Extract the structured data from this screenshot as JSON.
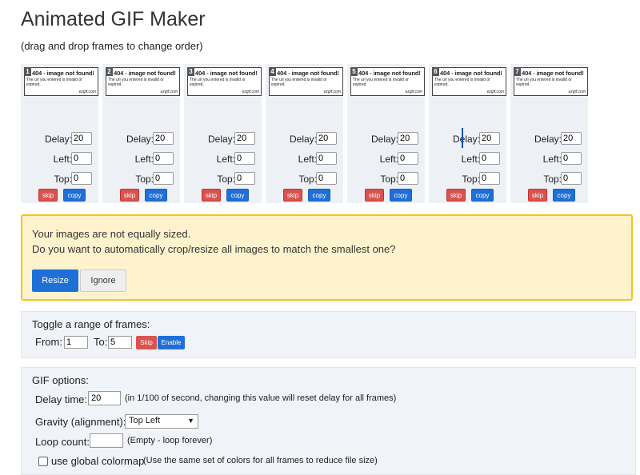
{
  "page": {
    "title": "Animated GIF Maker",
    "subtitle": "(drag and drop frames to change order)"
  },
  "frames": [
    {
      "number": "1",
      "delay": "20",
      "left": "0",
      "top": "0"
    },
    {
      "number": "2",
      "delay": "20",
      "left": "0",
      "top": "0"
    },
    {
      "number": "3",
      "delay": "20",
      "left": "0",
      "top": "0"
    },
    {
      "number": "4",
      "delay": "20",
      "left": "0",
      "top": "0"
    },
    {
      "number": "5",
      "delay": "20",
      "left": "0",
      "top": "0"
    },
    {
      "number": "6",
      "delay": "20",
      "left": "0",
      "top": "0"
    },
    {
      "number": "7",
      "delay": "20",
      "left": "0",
      "top": "0"
    }
  ],
  "frame_labels": {
    "thumb_heading": "404 - image not found!",
    "thumb_body": "The url you entered is invalid or expired.",
    "thumb_site": "ezgif.com",
    "delay": "Delay:",
    "left": "Left:",
    "top": "Top:",
    "skip": "skip",
    "copy": "copy"
  },
  "warning": {
    "line1": "Your images are not equally sized.",
    "line2": "Do you want to automatically crop/resize all images to match the smallest one?",
    "resize": "Resize",
    "ignore": "Ignore"
  },
  "toggle": {
    "heading": "Toggle a range of frames:",
    "from_label": "From:",
    "from_value": "1",
    "to_label": "To:",
    "to_value": "5",
    "skip": "Skip",
    "enable": "Enable"
  },
  "gif_options": {
    "heading": "GIF options:",
    "delay_label": "Delay time:",
    "delay_value": "20",
    "delay_note": "(in 1/100 of second, changing this value will reset delay for all frames)",
    "gravity_label": "Gravity (alignment):",
    "gravity_value": "Top Left",
    "loop_label": "Loop count:",
    "loop_value": "",
    "loop_note": "(Empty - loop forever)",
    "colormap_label": "use global colormap",
    "colormap_note": "(Use the same set of colors for all frames to reduce file size)"
  },
  "colors": {
    "skip_red": "#d9534f",
    "action_blue": "#1f6fd8",
    "warning_bg": "#fff3cd",
    "warning_border": "#f5c518"
  }
}
